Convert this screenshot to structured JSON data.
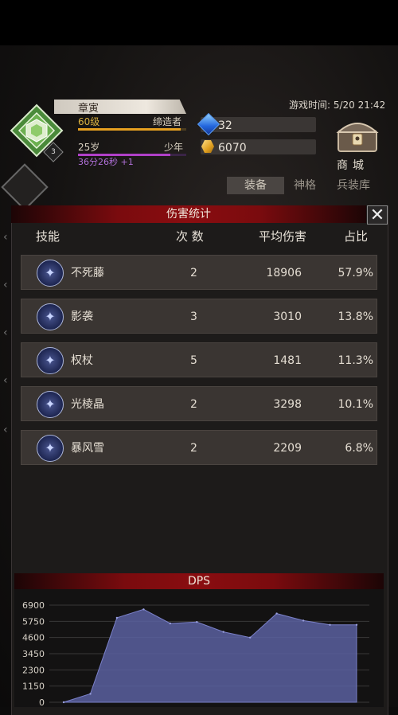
{
  "header": {
    "level_badge": "3",
    "player_name": "章寅",
    "level_text": "60级",
    "title_text": "缔造者",
    "age_text": "25岁",
    "age_stage": "少年",
    "timer_text": "36分26秒 +1",
    "level_progress": 0.95,
    "age_progress": 0.85,
    "game_time": "游戏时间: 5/20 21:42",
    "gems": "32",
    "gold": "6070",
    "shop_label": "商城"
  },
  "tabs": [
    "装备",
    "神格",
    "兵装库"
  ],
  "panel": {
    "title": "伤害统计",
    "close_icon": "✕",
    "columns": [
      "技能",
      "次 数",
      "平均伤害",
      "占比"
    ],
    "rows": [
      {
        "name": "不死藤",
        "count": "2",
        "avg": "18906",
        "pct": "57.9%",
        "icon": "vine-icon"
      },
      {
        "name": "影袭",
        "count": "3",
        "avg": "3010",
        "pct": "13.8%",
        "icon": "shadow-icon"
      },
      {
        "name": "权杖",
        "count": "5",
        "avg": "1481",
        "pct": "11.3%",
        "icon": "scepter-icon"
      },
      {
        "name": "光棱晶",
        "count": "2",
        "avg": "3298",
        "pct": "10.1%",
        "icon": "prism-icon"
      },
      {
        "name": "暴风雪",
        "count": "2",
        "avg": "2209",
        "pct": "6.8%",
        "icon": "blizzard-icon"
      }
    ]
  },
  "chart_data": {
    "type": "area",
    "title": "DPS",
    "y_ticks": [
      "6900",
      "5750",
      "4600",
      "3450",
      "2300",
      "1150",
      "0"
    ],
    "ylim": [
      0,
      6900
    ],
    "x": [
      0,
      1,
      2,
      3,
      4,
      5,
      6,
      7,
      8,
      9,
      10,
      11
    ],
    "values": [
      0,
      600,
      6000,
      6600,
      5600,
      5700,
      5000,
      4600,
      6300,
      5800,
      5500,
      5500
    ],
    "color": "#5a60a0"
  }
}
